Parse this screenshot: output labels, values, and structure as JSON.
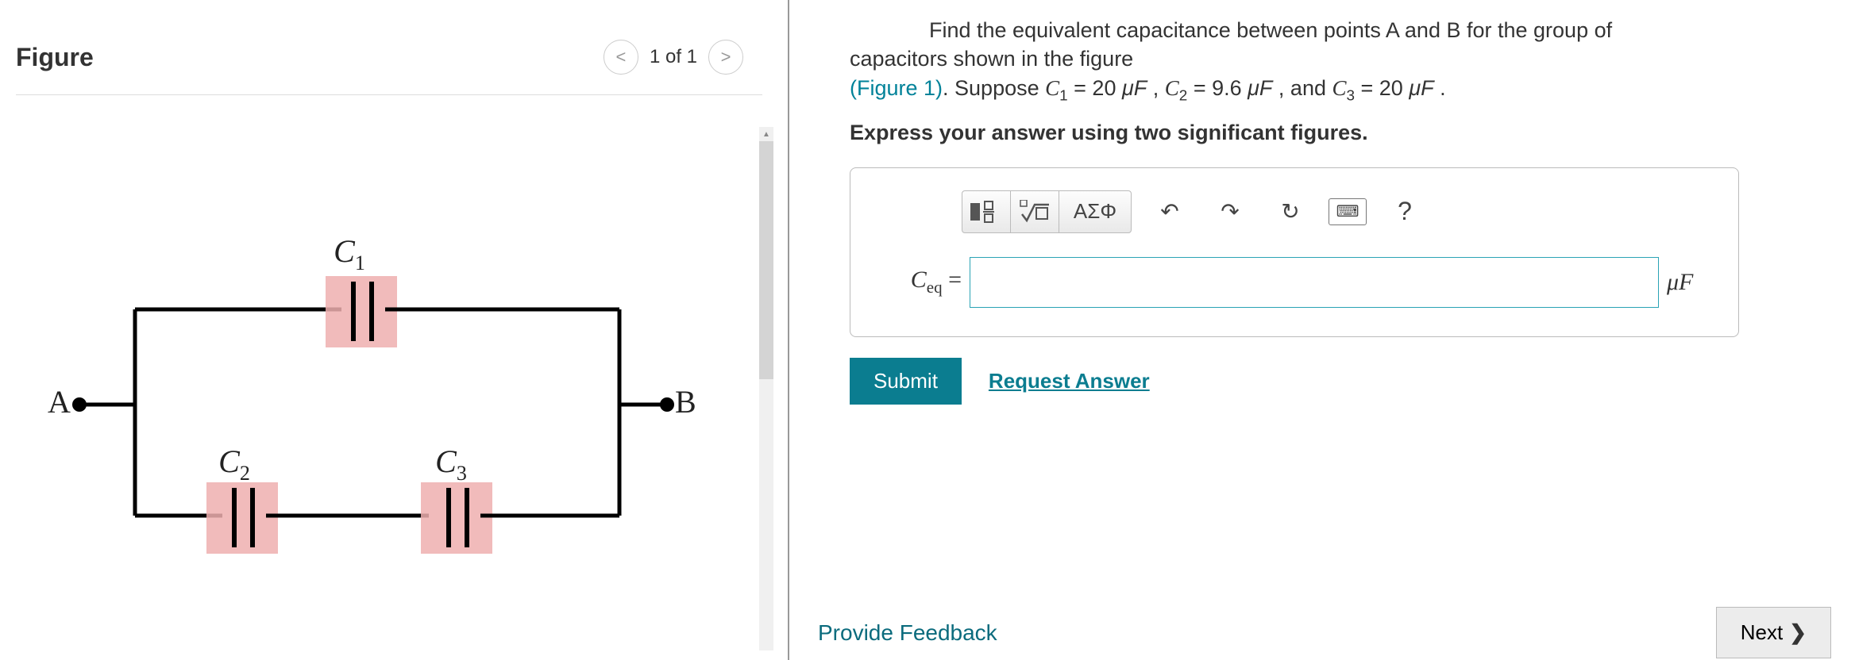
{
  "left": {
    "title": "Figure",
    "pager": {
      "prev": "<",
      "label": "1 of 1",
      "next": ">"
    },
    "circuit": {
      "node_a": "A",
      "node_b": "B",
      "c1": "C",
      "c1_sub": "1",
      "c2": "C",
      "c2_sub": "2",
      "c3": "C",
      "c3_sub": "3"
    }
  },
  "right": {
    "problem_line1": "Find the equivalent capacitance between points A and B for the group of",
    "problem_line2": "capacitors shown in the figure",
    "fig_link": "(Figure 1)",
    "period_after_fig": ". Suppose ",
    "c1var": "C",
    "sub1": "1",
    "eq1": " = 20 ",
    "unit1": "μF",
    "sep1": " , ",
    "c2var": "C",
    "sub2": "2",
    "eq2": " = 9.6 ",
    "unit2": "μF",
    "sep2": " , and ",
    "c3var": "C",
    "sub3": "3",
    "eq3": " = 20 ",
    "unit3": "μF",
    "tail": " .",
    "instruction": "Express your answer using two significant figures.",
    "toolbar": {
      "templates": "▮",
      "radical": "√",
      "greek": "ΑΣΦ",
      "undo": "↶",
      "redo": "↷",
      "reset": "↻",
      "keyboard": "⌨",
      "help": "?"
    },
    "answer": {
      "lhs_var": "C",
      "lhs_sub": "eq",
      "lhs_eq": " =",
      "value": "",
      "unit": "μF"
    },
    "submit": "Submit",
    "request": "Request Answer",
    "feedback": "Provide Feedback",
    "next": "Next"
  }
}
